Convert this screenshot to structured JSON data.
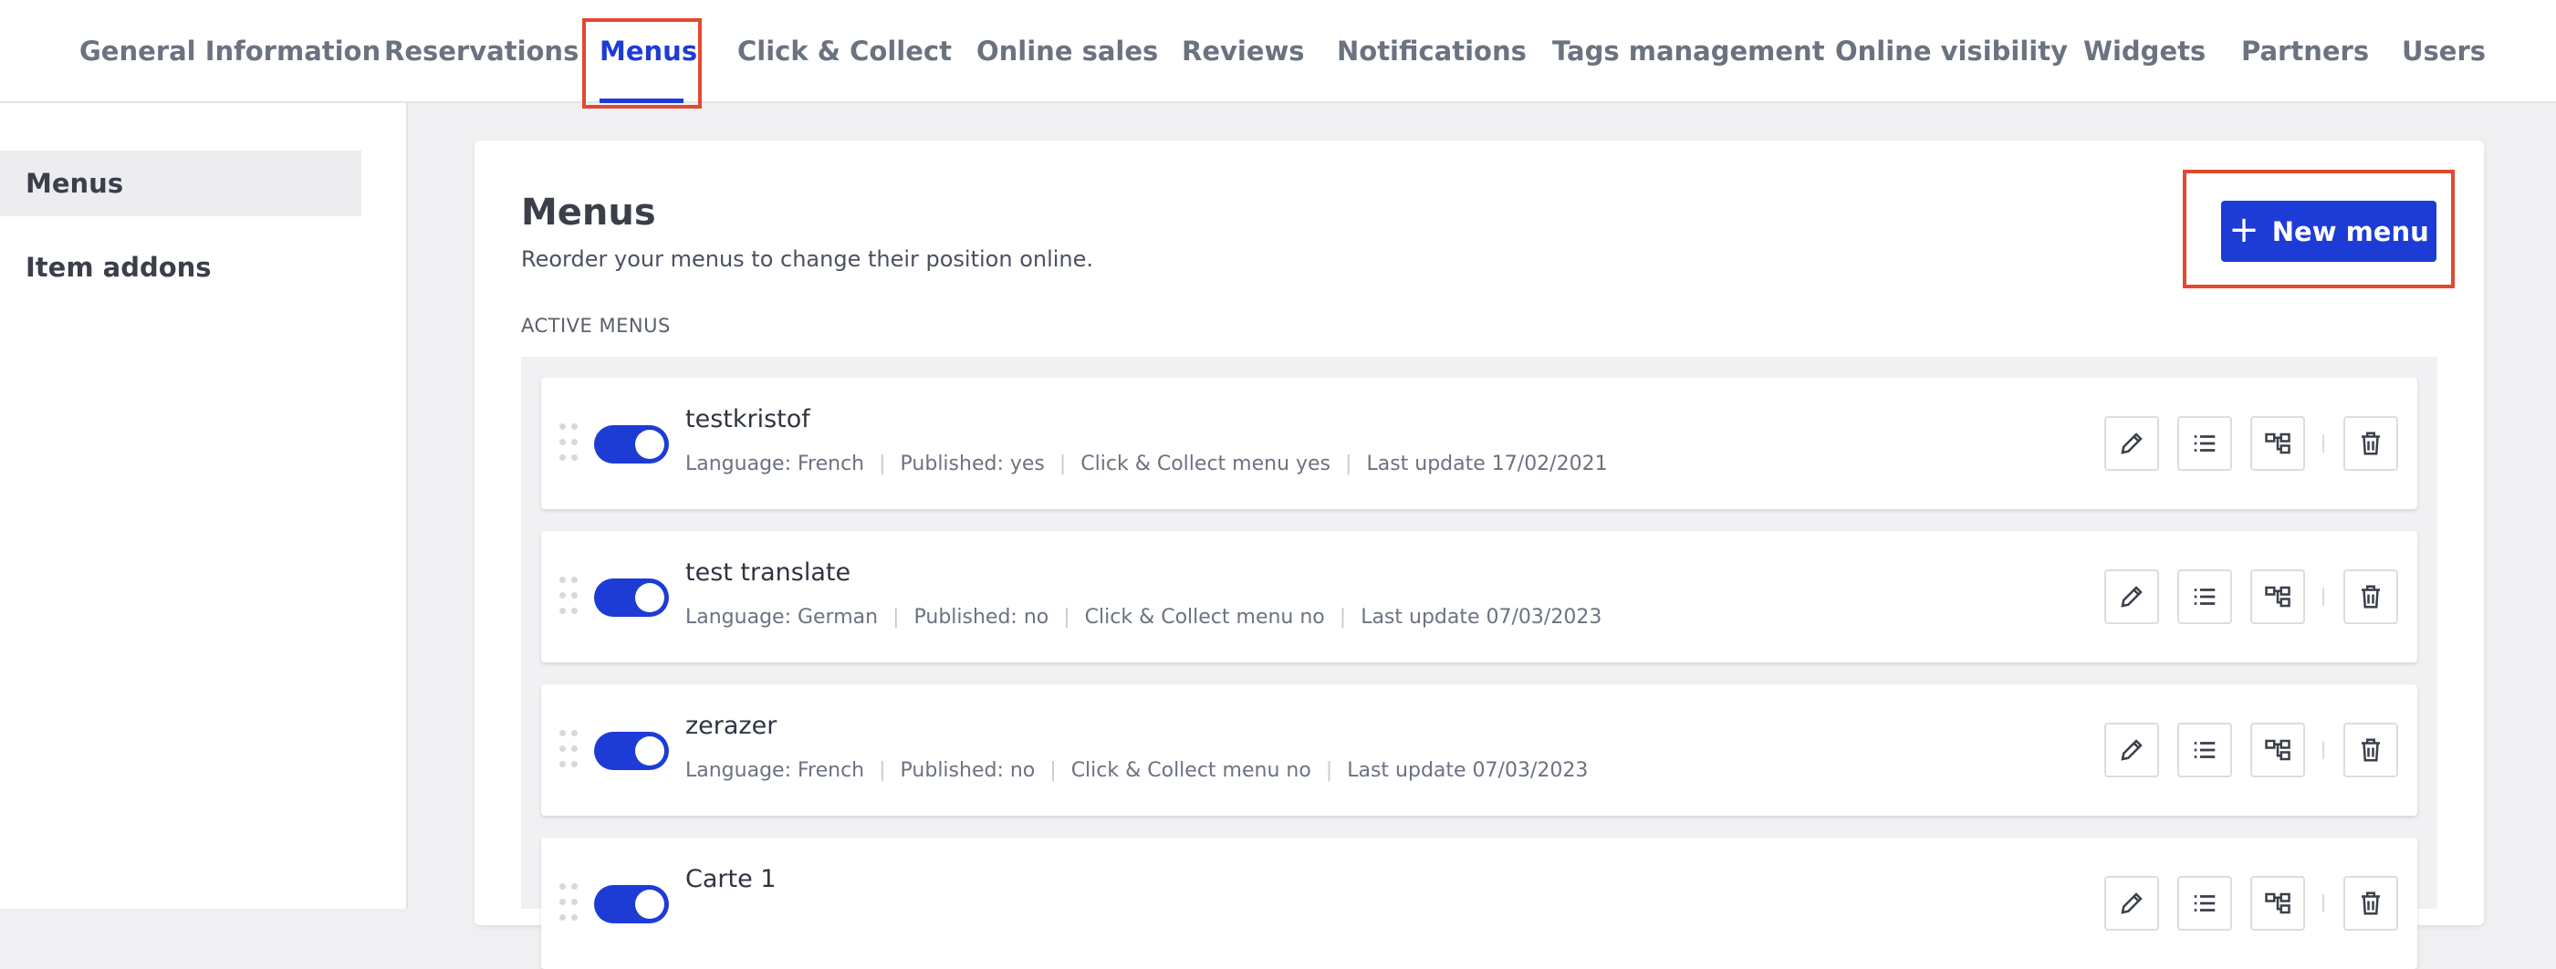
{
  "tabs": [
    {
      "label": "General Information"
    },
    {
      "label": "Reservations"
    },
    {
      "label": "Menus"
    },
    {
      "label": "Click & Collect"
    },
    {
      "label": "Online sales"
    },
    {
      "label": "Reviews"
    },
    {
      "label": "Notifications"
    },
    {
      "label": "Tags management"
    },
    {
      "label": "Online visibility"
    },
    {
      "label": "Widgets"
    },
    {
      "label": "Partners"
    },
    {
      "label": "Users"
    }
  ],
  "active_tab": "Menus",
  "sidebar": {
    "items": [
      {
        "label": "Menus",
        "selected": true
      },
      {
        "label": "Item addons",
        "selected": false
      }
    ]
  },
  "main": {
    "title": "Menus",
    "subtitle": "Reorder your menus to change their position online.",
    "new_button_label": "New menu",
    "section_label": "ACTIVE MENUS"
  },
  "menus": [
    {
      "name": "testkristof",
      "language": "Language: French",
      "published": "Published: yes",
      "click_collect": "Click & Collect menu yes",
      "last_update": "Last update 17/02/2021",
      "enabled": true
    },
    {
      "name": "test translate",
      "language": "Language: German",
      "published": "Published: no",
      "click_collect": "Click & Collect menu no",
      "last_update": "Last update 07/03/2023",
      "enabled": true
    },
    {
      "name": "zerazer",
      "language": "Language: French",
      "published": "Published: no",
      "click_collect": "Click & Collect menu no",
      "last_update": "Last update 07/03/2023",
      "enabled": true
    },
    {
      "name": "Carte 1",
      "language": "",
      "published": "",
      "click_collect": "",
      "last_update": "",
      "enabled": true
    }
  ],
  "icons": {
    "new": "plus-icon",
    "edit": "pencil-icon",
    "items": "list-icon",
    "structure": "hierarchy-icon",
    "delete": "trash-icon",
    "drag": "drag-handle-icon"
  },
  "colors": {
    "accent": "#1d3cd6",
    "annotation": "#e04a2f"
  }
}
